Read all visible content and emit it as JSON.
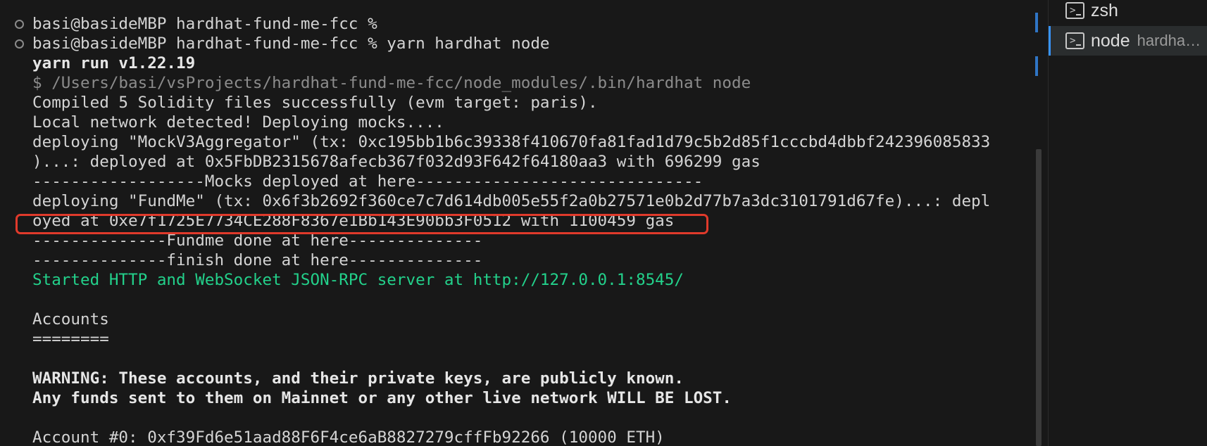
{
  "terminal": {
    "lines": [
      {
        "text": "basi@basideMBP hardhat-fund-me-fcc %",
        "style": "normal",
        "decoration": true
      },
      {
        "text": "basi@basideMBP hardhat-fund-me-fcc % yarn hardhat node",
        "style": "normal",
        "decoration": true
      },
      {
        "text": "yarn run v1.22.19",
        "style": "bold"
      },
      {
        "text": "$ /Users/basi/vsProjects/hardhat-fund-me-fcc/node_modules/.bin/hardhat node",
        "style": "dim"
      },
      {
        "text": "Compiled 5 Solidity files successfully (evm target: paris).",
        "style": "normal"
      },
      {
        "text": "Local network detected! Deploying mocks....",
        "style": "normal"
      },
      {
        "text": "deploying \"MockV3Aggregator\" (tx: 0xc195bb1b6c39338f410670fa81fad1d79c5b2d85f1cccbd4dbbf242396085833",
        "style": "normal"
      },
      {
        "text": ")...: deployed at 0x5FbDB2315678afecb367f032d93F642f64180aa3 with 696299 gas",
        "style": "normal"
      },
      {
        "text": "------------------Mocks deployed at here------------------------------",
        "style": "normal"
      },
      {
        "text": "deploying \"FundMe\" (tx: 0x6f3b2692f360ce7c7d614db005e55f2a0b27571e0b2d77b7a3dc3101791d67fe)...: depl",
        "style": "normal"
      },
      {
        "text": "oyed at 0xe7f1725E7734CE288F8367e1Bb143E90bb3F0512 with 1100459 gas",
        "style": "normal"
      },
      {
        "text": "--------------Fundme done at here--------------",
        "style": "normal"
      },
      {
        "text": "--------------finish done at here--------------",
        "style": "normal"
      },
      {
        "text": "Started HTTP and WebSocket JSON-RPC server at http://127.0.0.1:8545/",
        "style": "green"
      },
      {
        "text": "",
        "style": "normal"
      },
      {
        "text": "Accounts",
        "style": "normal"
      },
      {
        "text": "========",
        "style": "normal"
      },
      {
        "text": "",
        "style": "normal"
      },
      {
        "text": "WARNING: These accounts, and their private keys, are publicly known.",
        "style": "bold"
      },
      {
        "text": "Any funds sent to them on Mainnet or any other live network WILL BE LOST.",
        "style": "bold"
      },
      {
        "text": "",
        "style": "normal"
      },
      {
        "text": "Account #0: 0xf39Fd6e51aad88F6F4ce6aB8827279cffFb92266 (10000 ETH)",
        "style": "normal"
      }
    ]
  },
  "terminal_tabs": [
    {
      "icon": "terminal-icon",
      "label": "zsh",
      "desc": "",
      "active": false
    },
    {
      "icon": "terminal-icon",
      "label": "node",
      "desc": "hardhat-fund-me-fcc",
      "active": true
    }
  ],
  "colors": {
    "background": "#181818",
    "text": "#d4d4d4",
    "green": "#23d18b",
    "highlight": "#e03a2b",
    "accent": "#3794ff"
  }
}
